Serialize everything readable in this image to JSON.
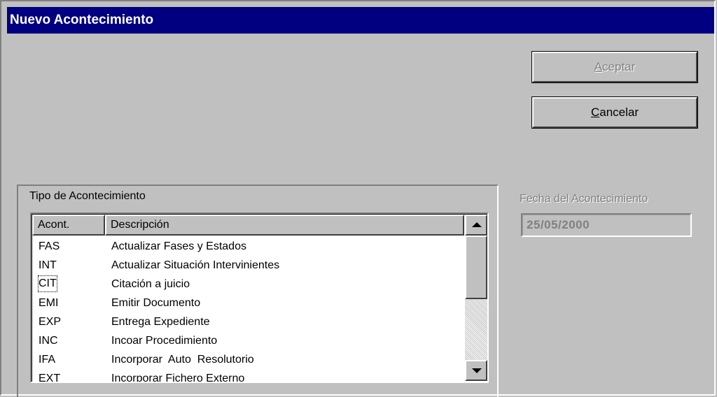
{
  "window": {
    "title": "Nuevo Acontecimiento"
  },
  "buttons": {
    "accept": {
      "label_prefix": "",
      "accel": "A",
      "label_rest": "ceptar",
      "enabled": false
    },
    "cancel": {
      "label_prefix": "",
      "accel": "C",
      "label_rest": "ancelar",
      "enabled": true
    }
  },
  "event_type": {
    "group_label": "Tipo de Acontecimiento",
    "columns": [
      "Acont.",
      "Descripción"
    ],
    "rows": [
      {
        "code": "FAS",
        "description": "Actualizar Fases y Estados"
      },
      {
        "code": "INT",
        "description": "Actualizar Situación Intervinientes"
      },
      {
        "code": "CIT",
        "description": "Citación a juicio",
        "focused": true
      },
      {
        "code": "EMI",
        "description": "Emitir Documento"
      },
      {
        "code": "EXP",
        "description": "Entrega Expediente"
      },
      {
        "code": "INC",
        "description": "Incoar Procedimiento"
      },
      {
        "code": "IFA",
        "description": "Incorporar  Auto  Resolutorio"
      },
      {
        "code": "EXT",
        "description": "Incorporar Fichero Externo"
      }
    ]
  },
  "event_date": {
    "label": "Fecha del Acontecimiento",
    "value": "25/05/2000",
    "enabled": false
  },
  "icons": {
    "scroll_up": "arrow-up-icon",
    "scroll_down": "arrow-down-icon"
  },
  "colors": {
    "titlebar": "#000080",
    "face": "#c0c0c0",
    "disabled_text": "#808080"
  }
}
